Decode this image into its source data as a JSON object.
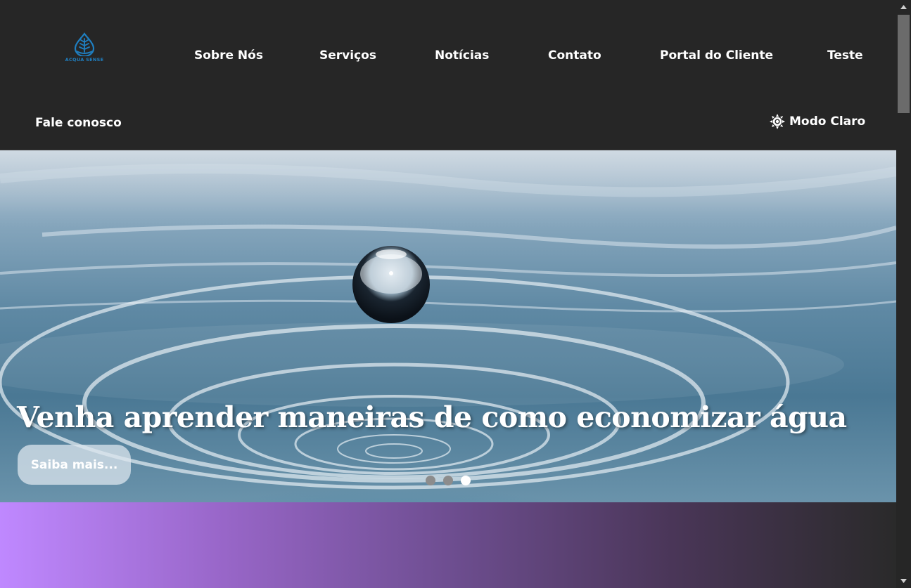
{
  "brand": {
    "logo_text": "ACQUA SENSE"
  },
  "nav": {
    "items": [
      {
        "label": "Sobre Nós"
      },
      {
        "label": "Serviços"
      },
      {
        "label": "Notícias"
      },
      {
        "label": "Contato"
      },
      {
        "label": "Portal do Cliente"
      },
      {
        "label": "Teste"
      }
    ],
    "fale_conosco": "Fale conosco",
    "mode_toggle": "Modo Claro"
  },
  "hero": {
    "title": "Venha aprender maneiras de como economizar água",
    "button_label": "Saiba mais...",
    "carousel": {
      "slides": 3,
      "active": 3
    }
  },
  "colors": {
    "header_bg": "#262626",
    "band_gradient_start": "#bf88ff",
    "band_gradient_end": "#2a2a2a",
    "logo_blue": "#1f7fc1"
  }
}
